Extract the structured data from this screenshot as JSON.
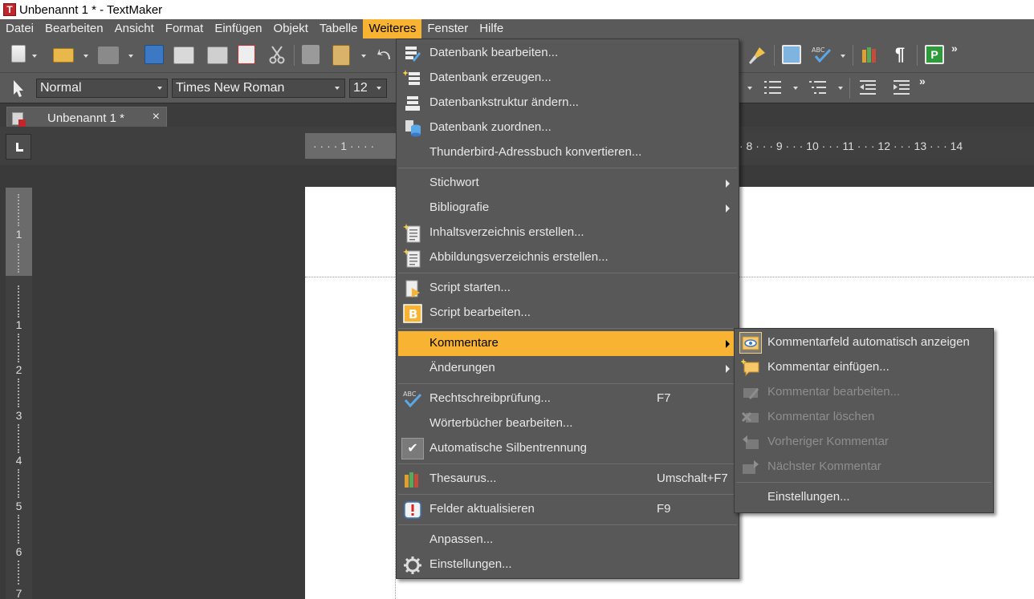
{
  "window": {
    "title": "Unbenannt 1 * - TextMaker",
    "app_icon_letter": "T"
  },
  "menubar": [
    {
      "label": "Datei"
    },
    {
      "label": "Bearbeiten"
    },
    {
      "label": "Ansicht"
    },
    {
      "label": "Format"
    },
    {
      "label": "Einfügen"
    },
    {
      "label": "Objekt"
    },
    {
      "label": "Tabelle"
    },
    {
      "label": "Weiteres",
      "active": true
    },
    {
      "label": "Fenster"
    },
    {
      "label": "Hilfe"
    }
  ],
  "formatbar": {
    "style": "Normal",
    "font": "Times New Roman",
    "size": "12"
  },
  "tab": {
    "label": "Unbenannt 1 *",
    "close": "×"
  },
  "ruler": {
    "left_marks": "· · · · 1 · · · ·",
    "right_marks": "· 8 · · · 9 · · · 10 · · · 11 · · · 12 · · · 13 · · · 14",
    "vertical": [
      "1",
      "1",
      "2",
      "3",
      "4",
      "5",
      "6",
      "7"
    ]
  },
  "weiteres_menu": {
    "items": [
      {
        "label": "Datenbank bearbeiten...",
        "icon": "db-edit-icon"
      },
      {
        "label": "Datenbank erzeugen...",
        "icon": "db-new-icon"
      },
      {
        "label": "Datenbankstruktur ändern...",
        "icon": "db-structure-icon"
      },
      {
        "label": "Datenbank zuordnen...",
        "icon": "db-assign-icon"
      },
      {
        "label": "Thunderbird-Adressbuch konvertieren...",
        "icon": ""
      },
      {
        "label": "Stichwort",
        "submenu": true
      },
      {
        "label": "Bibliografie",
        "submenu": true
      },
      {
        "label": "Inhaltsverzeichnis erstellen...",
        "icon": "toc-icon"
      },
      {
        "label": "Abbildungsverzeichnis erstellen...",
        "icon": "figure-index-icon"
      },
      {
        "label": "Script starten...",
        "icon": "script-run-icon"
      },
      {
        "label": "Script bearbeiten...",
        "icon": "script-edit-icon"
      },
      {
        "label": "Kommentare",
        "submenu": true,
        "highlighted": true
      },
      {
        "label": "Änderungen",
        "submenu": true
      },
      {
        "label": "Rechtschreibprüfung...",
        "icon": "spellcheck-icon",
        "shortcut": "F7"
      },
      {
        "label": "Wörterbücher bearbeiten...",
        "icon": ""
      },
      {
        "label": "Automatische Silbentrennung",
        "checked": true
      },
      {
        "label": "Thesaurus...",
        "icon": "thesaurus-icon",
        "shortcut": "Umschalt+F7"
      },
      {
        "label": "Felder aktualisieren",
        "icon": "update-fields-icon",
        "shortcut": "F9"
      },
      {
        "label": "Anpassen...",
        "icon": ""
      },
      {
        "label": "Einstellungen...",
        "icon": "gear-icon"
      }
    ]
  },
  "kommentare_menu": {
    "items": [
      {
        "label": "Kommentarfeld automatisch anzeigen",
        "icon": "comment-show-icon",
        "checked": true
      },
      {
        "label": "Kommentar einfügen...",
        "icon": "comment-insert-icon"
      },
      {
        "label": "Kommentar bearbeiten...",
        "icon": "comment-edit-icon",
        "disabled": true
      },
      {
        "label": "Kommentar löschen",
        "icon": "comment-delete-icon",
        "disabled": true
      },
      {
        "label": "Vorheriger Kommentar",
        "icon": "comment-prev-icon",
        "disabled": true
      },
      {
        "label": "Nächster Kommentar",
        "icon": "comment-next-icon",
        "disabled": true
      },
      {
        "label": "Einstellungen...",
        "icon": ""
      }
    ]
  },
  "colors": {
    "accent": "#f7b331",
    "menu_bg": "#585858",
    "toolbar_bg": "#5a5a5a"
  }
}
